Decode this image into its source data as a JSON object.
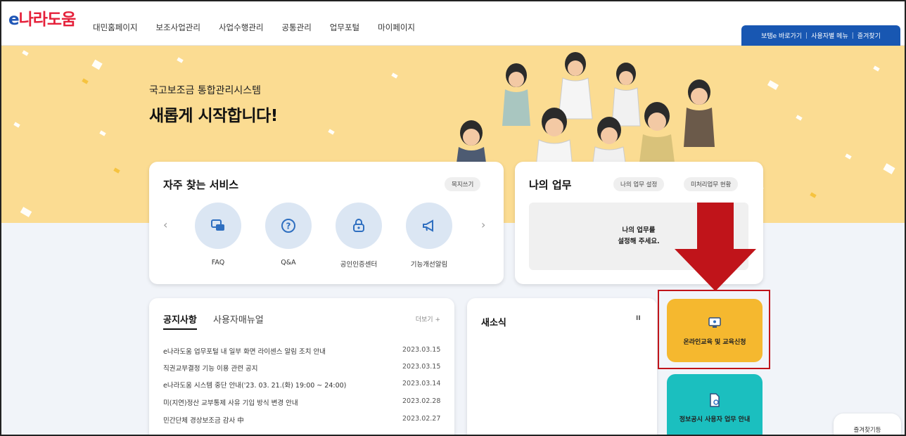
{
  "header": {
    "logo": {
      "e": "e",
      "rest": "나라도움"
    },
    "nav": [
      "대민홈페이지",
      "보조사업관리",
      "사업수행관리",
      "공통관리",
      "업무포털",
      "마이페이지"
    ],
    "quick_links": [
      "보탬e 바로가기",
      "사용자별 메뉴",
      "즐겨찾기"
    ]
  },
  "hero": {
    "subtitle": "국고보조금 통합관리시스템",
    "title": "새롭게 시작합니다!"
  },
  "frequent_services": {
    "title": "자주 찾는 서비스",
    "edit_button": "목지쓰기",
    "items": [
      {
        "label": "FAQ",
        "icon": "chat-icon"
      },
      {
        "label": "Q&A",
        "icon": "question-icon"
      },
      {
        "label": "공인인증센터",
        "icon": "lock-icon"
      },
      {
        "label": "기능개선알림",
        "icon": "megaphone-icon"
      }
    ]
  },
  "my_work": {
    "title": "나의 업무",
    "settings_button": "나의 업무 설정",
    "pending_button": "미처리업무 현황",
    "empty_line1": "나의 업무를",
    "empty_line2": "설정해 주세요."
  },
  "notices": {
    "tabs": [
      "공지사항",
      "사용자매뉴얼"
    ],
    "more": "더보기 +",
    "rows": [
      {
        "title": "e나라도움 업무포털 내 일부 화면 라이센스 알림 조치 안내",
        "date": "2023.03.15"
      },
      {
        "title": "직권교부결정 기능 이용 관련 공지",
        "date": "2023.03.15"
      },
      {
        "title": "e나라도움 시스템 중단 안내('23. 03. 21.(화) 19:00 ~ 24:00)",
        "date": "2023.03.14"
      },
      {
        "title": "미(지연)정산 교부통제 사유 기입 방식 변경 안내",
        "date": "2023.02.28"
      },
      {
        "title": "민간단체 경상보조금 감사 中",
        "date": "2023.02.27"
      }
    ]
  },
  "news": {
    "title": "새소식",
    "pause": "II"
  },
  "actions": {
    "online_education": "온라인교육 및 교육신청",
    "disclosure_guide": "정보공시 사용자 업무 안내"
  },
  "favorites": "즐겨찾기등",
  "colors": {
    "brand_blue": "#1857b2",
    "hero_yellow": "#fbdc92",
    "education_yellow": "#f5b82f",
    "guide_teal": "#1bbfbf",
    "highlight_red": "#c0141a"
  }
}
